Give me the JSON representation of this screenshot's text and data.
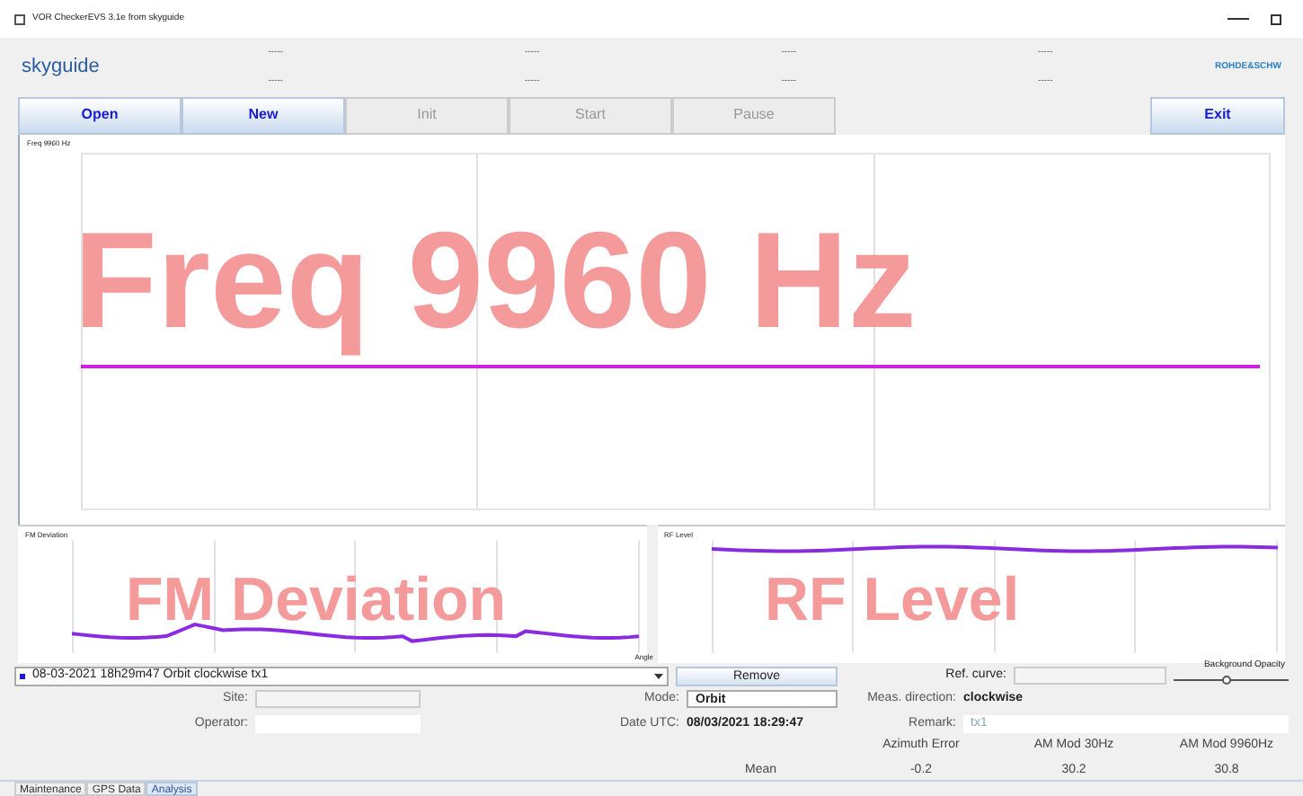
{
  "window": {
    "title": "VOR CheckerEVS 3.1e from skyguide"
  },
  "header": {
    "logo": "skyguide",
    "partner_logo": "ROHDE&SCHW",
    "readouts": [
      "-----",
      "-----",
      "-----",
      "-----",
      "-----",
      "-----",
      "-----",
      "-----"
    ]
  },
  "toolbar": [
    {
      "label": "Open",
      "disabled": false
    },
    {
      "label": "New",
      "disabled": false
    },
    {
      "label": "Init",
      "disabled": true
    },
    {
      "label": "Start",
      "disabled": true
    },
    {
      "label": "Pause",
      "disabled": true
    }
  ],
  "exit_button": "Exit",
  "main_chart": {
    "title": "Freq 9960 Hz",
    "watermark": "Freq 9960 Hz"
  },
  "lower_charts": [
    {
      "title": "FM Deviation",
      "watermark": "FM Deviation",
      "kind": "wavy"
    },
    {
      "title": "RF Level",
      "watermark": "RF Level",
      "kind": "flat"
    }
  ],
  "angle_label": "Angle",
  "measurement": {
    "entry": "08-03-2021 18h29m47 Orbit clockwise tx1",
    "remove_button": "Remove",
    "ref_curve_label": "Ref. curve:",
    "opacity_label": "Background Opacity",
    "opacity": {
      "level": 0.45
    }
  },
  "form": {
    "site_label": "Site:",
    "mode_label": "Mode:",
    "mode_value": "Orbit",
    "direction_label": "Meas. direction:",
    "direction_value": "clockwise",
    "operator_label": "Operator:",
    "date_label": "Date UTC:",
    "date_value": "08/03/2021 18:29:47",
    "remark_label": "Remark:",
    "remark_value": "tx1"
  },
  "results": {
    "columns": [
      "Azimuth Error",
      "AM Mod 30Hz",
      "AM Mod 9960Hz"
    ],
    "row_label": "Mean",
    "values": [
      "-0.2",
      "30.2",
      "30.8"
    ]
  },
  "tabs": [
    {
      "label": "Maintenance",
      "selected": false
    },
    {
      "label": "GPS Data",
      "selected": false
    },
    {
      "label": "Analysis",
      "selected": true
    }
  ]
}
